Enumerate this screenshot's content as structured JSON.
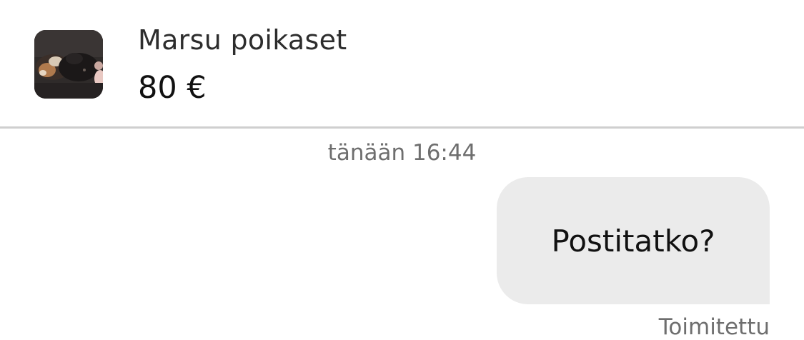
{
  "listing": {
    "title": "Marsu poikaset",
    "price": "80 €",
    "thumbnail_icon": "guinea-pig-photo"
  },
  "conversation": {
    "timestamp": "tänään 16:44",
    "messages": [
      {
        "direction": "outgoing",
        "text": "Postitatko?",
        "status": "Toimitettu"
      }
    ]
  },
  "colors": {
    "bubble_outgoing": "#ebebeb",
    "divider": "#cfcfcf",
    "meta_text": "#6e6e6e"
  }
}
